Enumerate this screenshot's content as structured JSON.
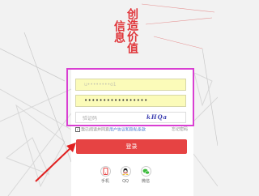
{
  "slogan": {
    "line1": "创造价值",
    "line2": "信息"
  },
  "form": {
    "username_value": "u••••••••o1",
    "password_value": "•••••••••••••••••",
    "captcha_placeholder": "验证码",
    "captcha_text": "kHQa",
    "agree_checkbox": "✓",
    "agree_text": "我已阅读并同意",
    "agree_link": "用户协议和隐私条款",
    "forgot_link": "忘记密码",
    "login_label": "登录"
  },
  "social": [
    {
      "label": "手机",
      "icon": "phone-icon"
    },
    {
      "label": "QQ",
      "icon": "qq-icon"
    },
    {
      "label": "微信",
      "icon": "wechat-icon"
    }
  ],
  "colors": {
    "accent": "#e64343",
    "highlight": "#d93fd2",
    "autofill": "#fbfbb9",
    "arrow": "#e02020"
  }
}
